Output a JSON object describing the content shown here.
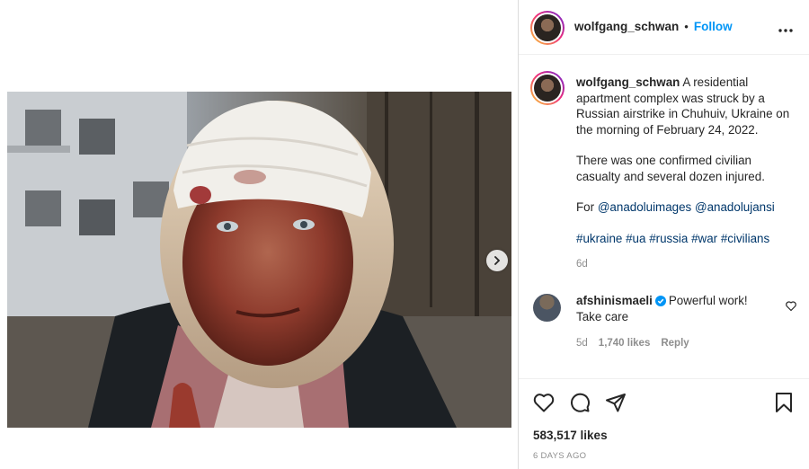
{
  "post": {
    "username": "wolfgang_schwan",
    "follow_label": "Follow",
    "separator": "•",
    "more_label": "•••",
    "next_icon": "chevron-right-icon"
  },
  "caption": {
    "username": "wolfgang_schwan",
    "text_1": "A residential apartment complex was struck by a Russian airstrike in Chuhuiv, Ukraine on the morning of February 24, 2022.",
    "text_2": "There was one confirmed civilian casualty and several dozen injured.",
    "for_label": "For",
    "mention_1": "@anadoluimages",
    "mention_2": "@anadolujansi",
    "hashtags": [
      "#ukraine",
      "#ua",
      "#russia",
      "#war",
      "#civilians"
    ],
    "age": "6d"
  },
  "comment": {
    "username": "afshinismaeli",
    "text": "Powerful work! Take care",
    "age": "5d",
    "likes": "1,740 likes",
    "reply_label": "Reply"
  },
  "footer": {
    "likes": "583,517 likes",
    "time_ago": "6 DAYS AGO"
  },
  "colors": {
    "accent": "#0095f6",
    "link": "#00376b",
    "muted": "#8e8e8e",
    "text": "#262626"
  }
}
